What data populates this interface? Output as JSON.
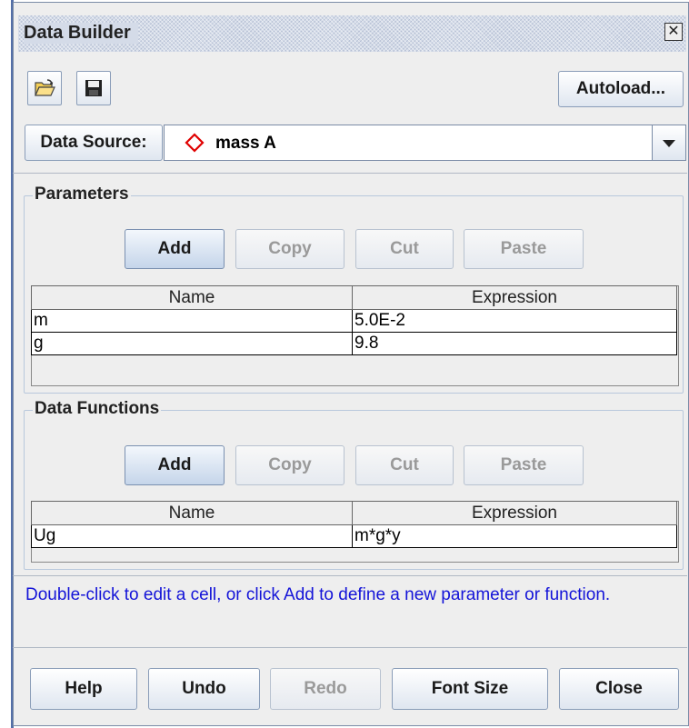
{
  "window": {
    "title": "Data Builder"
  },
  "toolbar": {
    "autoload_label": "Autoload..."
  },
  "data_source": {
    "label": "Data Source:",
    "value": "mass A",
    "marker_color": "#e00000"
  },
  "parameters": {
    "title": "Parameters",
    "buttons": {
      "add": "Add",
      "copy": "Copy",
      "cut": "Cut",
      "paste": "Paste"
    },
    "columns": [
      "Name",
      "Expression"
    ],
    "rows": [
      {
        "name": "m",
        "expression": "5.0E-2"
      },
      {
        "name": "g",
        "expression": "9.8"
      }
    ]
  },
  "functions": {
    "title": "Data Functions",
    "buttons": {
      "add": "Add",
      "copy": "Copy",
      "cut": "Cut",
      "paste": "Paste"
    },
    "columns": [
      "Name",
      "Expression"
    ],
    "rows": [
      {
        "name": "Ug",
        "expression": "m*g*y"
      }
    ]
  },
  "hint": "Double-click to edit a cell, or click Add to define a new parameter or function.",
  "footer": {
    "help": "Help",
    "undo": "Undo",
    "redo": "Redo",
    "font_size": "Font Size",
    "close": "Close"
  },
  "icons": {
    "open": "folder-open-icon",
    "save": "floppy-save-icon",
    "close": "close-x-icon",
    "dropdown": "chevron-down-icon"
  }
}
